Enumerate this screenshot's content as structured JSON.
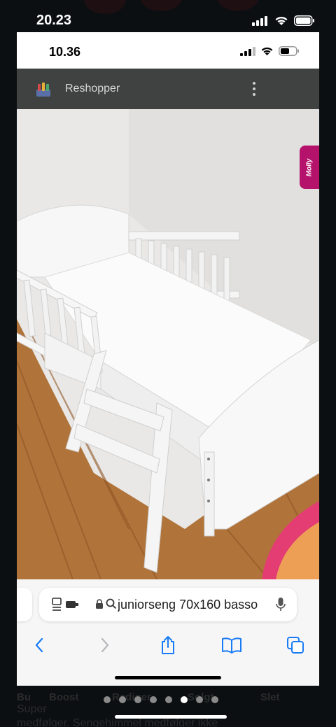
{
  "outer_status": {
    "time": "20.23"
  },
  "inner_status": {
    "time": "10.36"
  },
  "app": {
    "title": "Reshopper",
    "badge": "Molly"
  },
  "photo": {
    "subject": "white junior bed with mattress and ladder"
  },
  "browser": {
    "url": "juniorseng 70x160 basso",
    "icons": [
      "tab-switch-icon",
      "lock-icon",
      "search-icon",
      "mic-icon"
    ],
    "nav": [
      "back-icon",
      "forward-icon",
      "share-icon",
      "bookmarks-icon",
      "tabs-icon"
    ]
  },
  "background": {
    "actions": {
      "boost": "Boost",
      "edit": "Rediger",
      "sold": "Solgt",
      "delete": "Slet"
    },
    "heading_start": "Bu",
    "desc_line1": "Super",
    "desc_line2": "medfølger. Sengehimmel medfølger ikke"
  },
  "pager": {
    "count": 8,
    "active_index": 5
  },
  "colors": {
    "accent": "#1a7cf5",
    "header": "#404141",
    "molly": "#b5126b"
  }
}
